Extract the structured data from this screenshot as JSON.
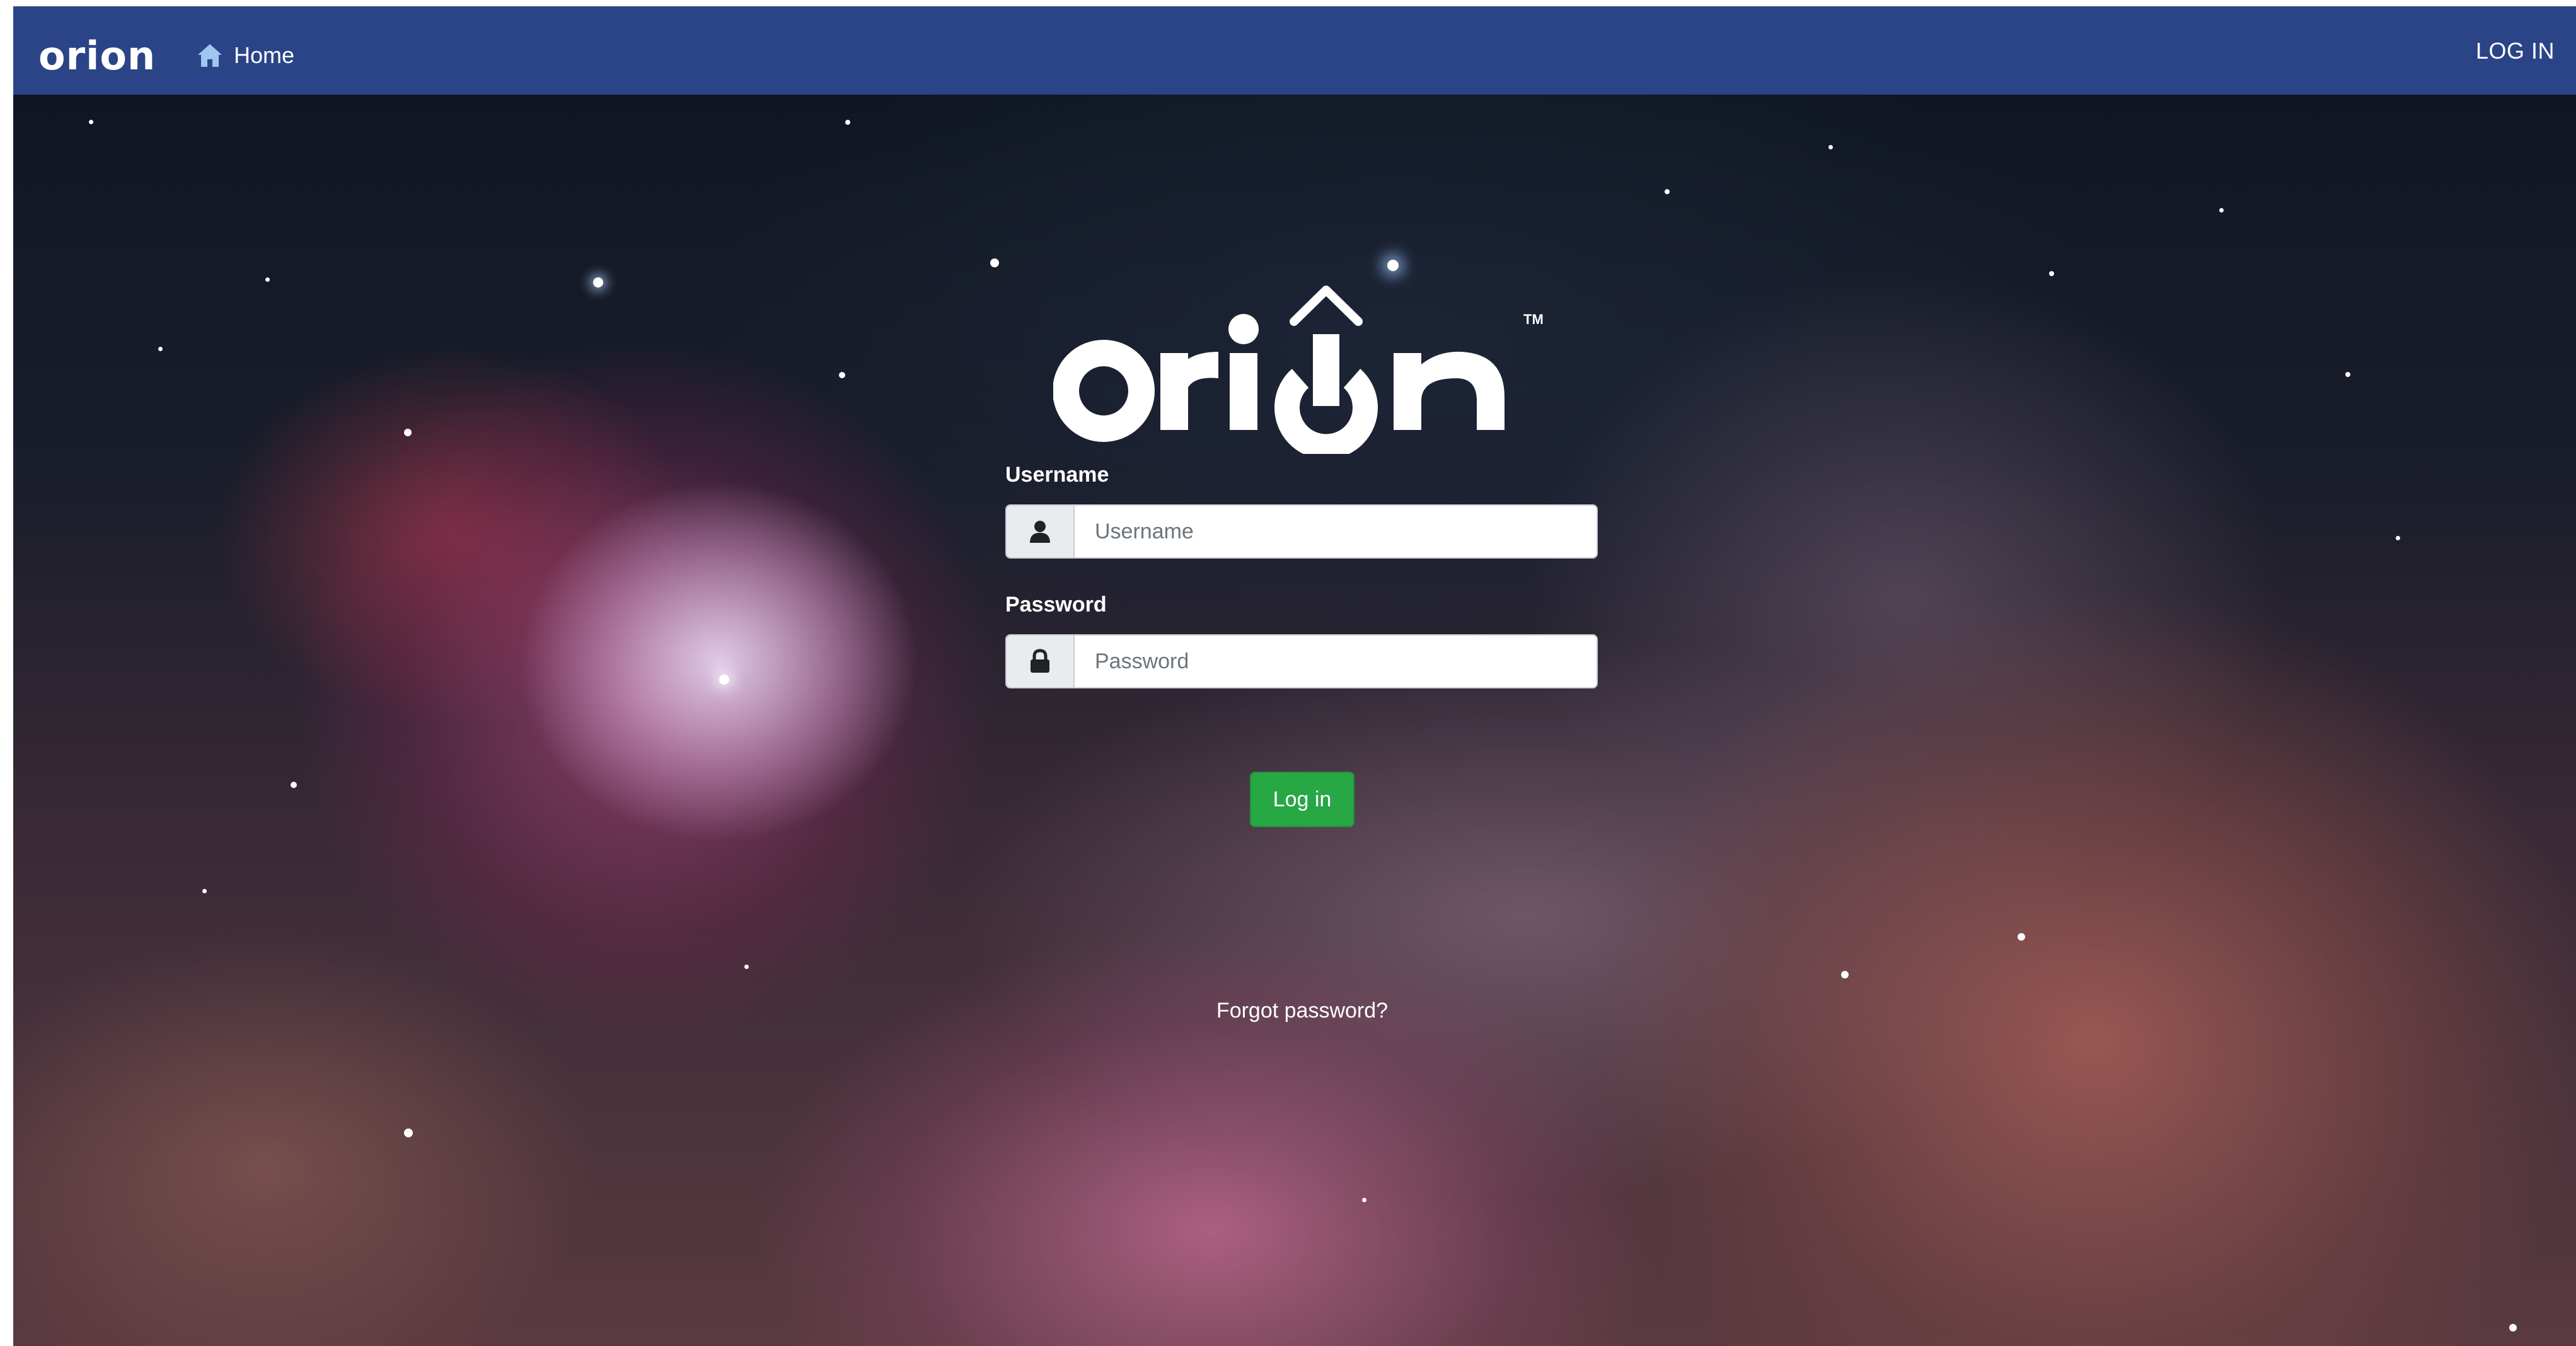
{
  "brand": {
    "logo_text": "orion",
    "trademark": "TM"
  },
  "nav": {
    "home_label": "Home",
    "login_label": "LOG IN"
  },
  "login": {
    "username_label": "Username",
    "username_placeholder": "Username",
    "username_value": "",
    "password_label": "Password",
    "password_placeholder": "Password",
    "password_value": "",
    "submit_label": "Log in",
    "forgot_label": "Forgot password?"
  },
  "colors": {
    "navbar": "#2b4487",
    "button": "#28a745",
    "text": "#ffffff"
  },
  "icons": {
    "home": "home-icon",
    "username": "user-icon",
    "password": "lock-icon"
  }
}
